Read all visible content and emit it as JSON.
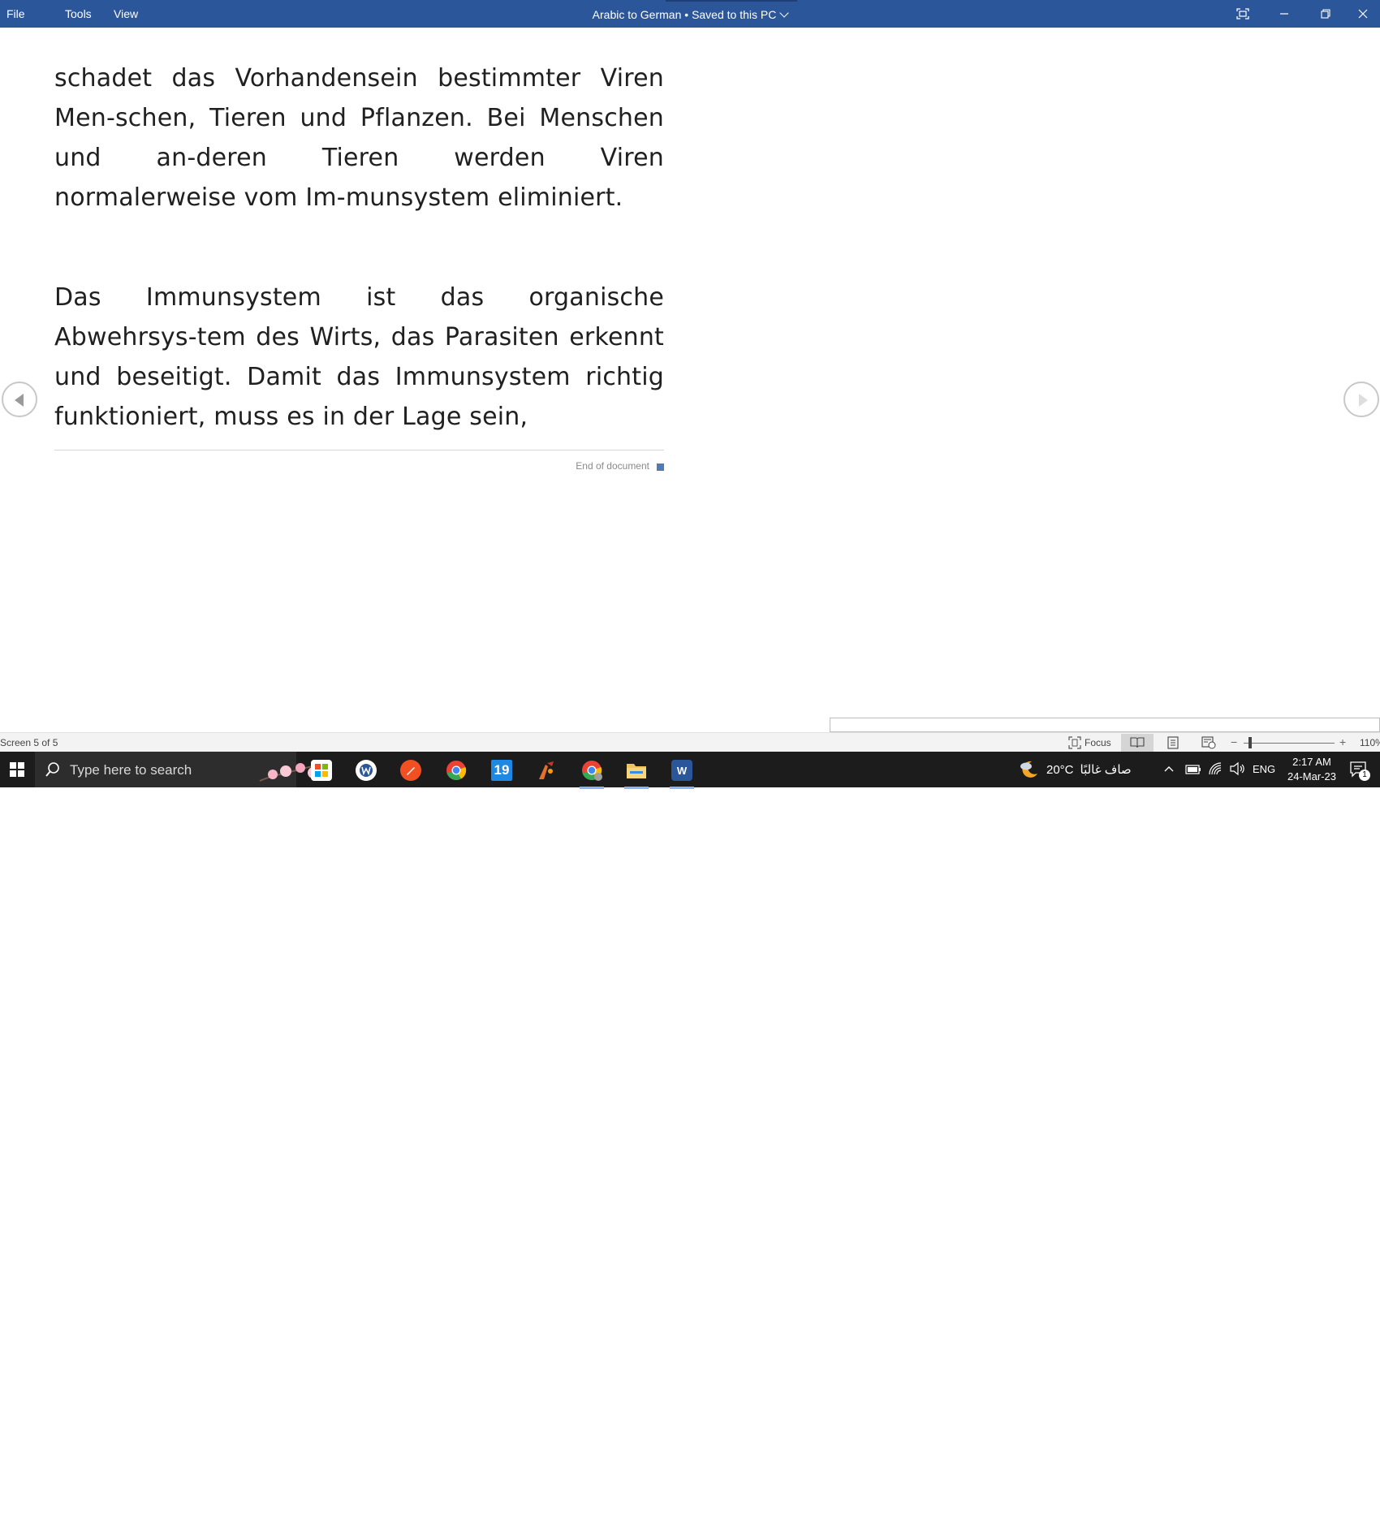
{
  "titlebar": {
    "menus": [
      "File",
      "Tools",
      "View"
    ],
    "doc_name": "Arabic to German",
    "separator": "•",
    "save_status": "Saved to this PC"
  },
  "document": {
    "paragraph1": "schadet das Vorhandensein bestimmter Viren Men-schen, Tieren und Pflanzen. Bei Menschen und an-deren Tieren werden Viren normalerweise vom Im-munsystem eliminiert.",
    "paragraph2": "Das Immunsystem ist das organische Abwehrsys-tem des Wirts, das Parasiten erkennt und beseitigt. Damit das Immunsystem richtig funktioniert, muss es in der Lage sein,",
    "end_label": "End of document",
    "accent_color": "#4f7cb7"
  },
  "statusbar": {
    "screen_info": "Screen 5 of 5",
    "focus_label": "Focus",
    "zoom_level": "110%",
    "views": [
      "read-mode",
      "print-layout",
      "web-layout"
    ],
    "active_view": "read-mode"
  },
  "taskbar": {
    "search_placeholder": "Type here to search",
    "apps": [
      {
        "name": "microsoft-store",
        "color": "#f3b21a",
        "running": false
      },
      {
        "name": "word-app-alt",
        "color": "#2b579a",
        "running": false
      },
      {
        "name": "pen-app",
        "color": "#f25022",
        "running": false
      },
      {
        "name": "chrome",
        "color": "#ea4335",
        "running": false
      },
      {
        "name": "nineteen-app",
        "color": "#1e88e5",
        "running": false
      },
      {
        "name": "hand-app",
        "color": "#e5702a",
        "running": false
      },
      {
        "name": "chrome-profile",
        "color": "#ea4335",
        "running": true
      },
      {
        "name": "file-explorer",
        "color": "#f1c35b",
        "running": true
      },
      {
        "name": "word",
        "color": "#2b579a",
        "running": true
      }
    ],
    "weather_temp": "20°C",
    "weather_text": "صاف غالبًا",
    "language": "ENG",
    "time": "2:17 AM",
    "date": "24-Mar-23",
    "notification_count": "1",
    "nineteen_label": "19",
    "word_letter": "W"
  },
  "colors": {
    "titlebar_bg": "#2b579a",
    "taskbar_bg": "#1c1c1c"
  }
}
